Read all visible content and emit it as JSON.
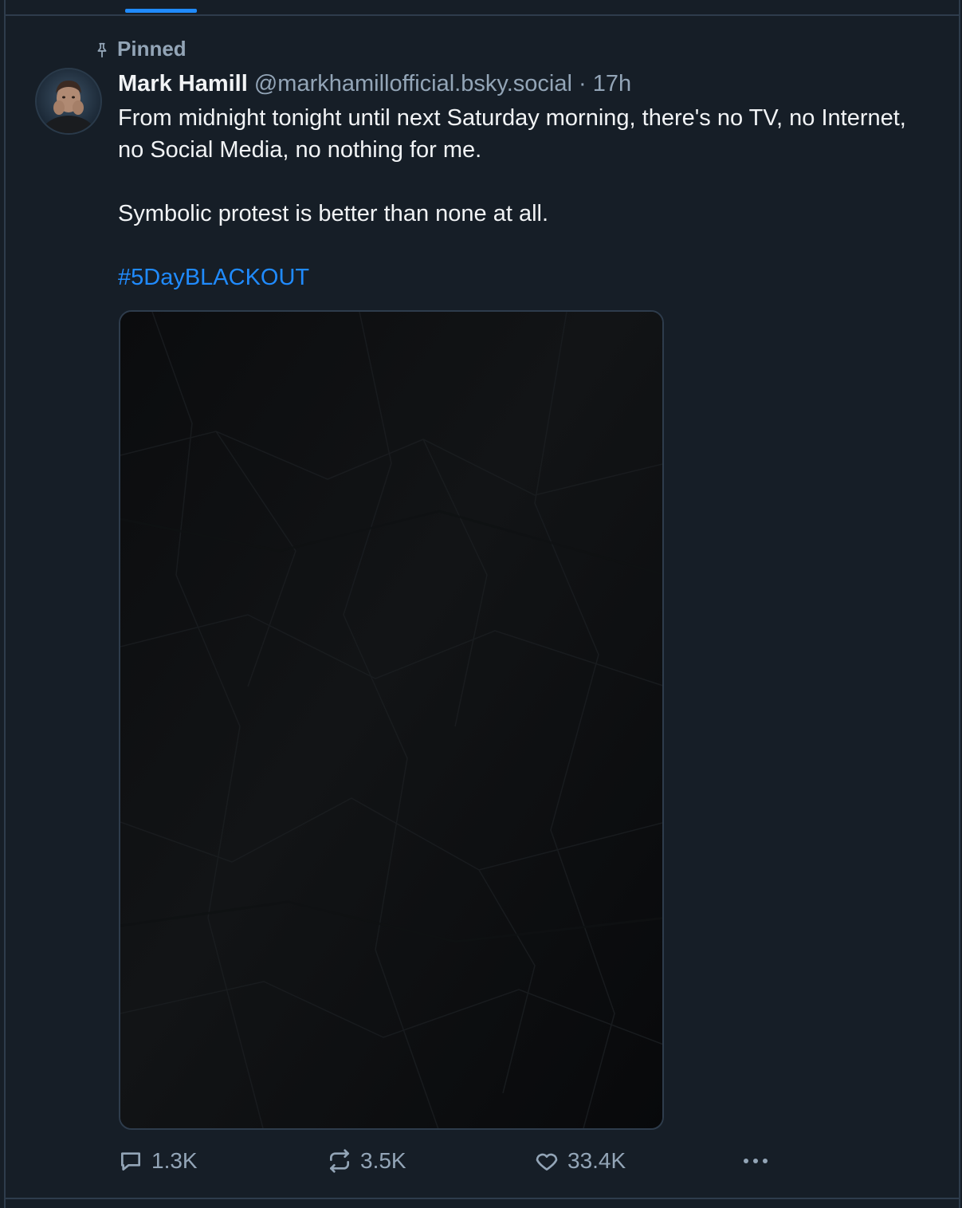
{
  "feed": {
    "active_tab_accent": "#208bfe"
  },
  "post": {
    "pinned_label": "Pinned",
    "author": {
      "display_name": "Mark Hamill",
      "handle": "@markhamillofficial.bsky.social",
      "avatar_icon": "user-avatar"
    },
    "separator": "·",
    "timestamp": "17h",
    "text": {
      "line1": "From midnight tonight until next Saturday morning, there's no TV, no Internet, no Social Media, no nothing for me.",
      "line2": "Symbolic protest is better than none at all.",
      "hashtag": "#5DayBLACKOUT"
    },
    "media": {
      "kind": "image",
      "description_color": "#0b0c0e"
    },
    "actions": {
      "replies": "1.3K",
      "reposts": "3.5K",
      "likes": "33.4K"
    }
  },
  "colors": {
    "background": "#161e27",
    "border": "#2e3c4c",
    "text_primary": "#f1f3f5",
    "text_secondary": "#93a5b7",
    "link": "#208bfe"
  }
}
